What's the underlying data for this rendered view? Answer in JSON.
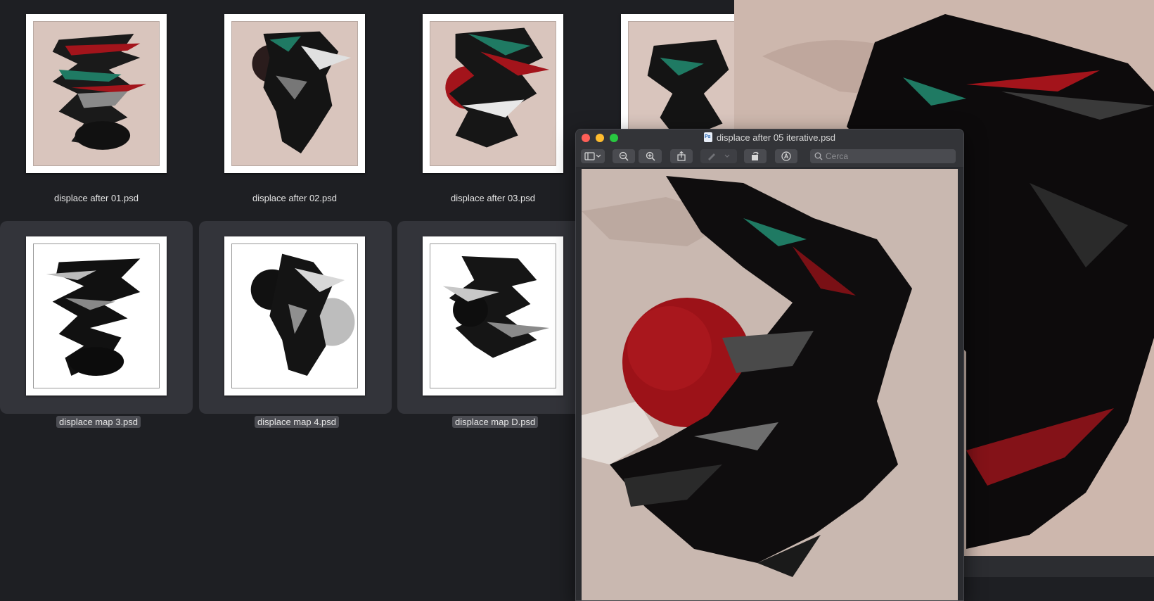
{
  "finder": {
    "files": [
      {
        "name": "displace after 01.psd",
        "selected": false,
        "style": "tinted"
      },
      {
        "name": "displace after 02.psd",
        "selected": false,
        "style": "tinted"
      },
      {
        "name": "displace after 03.psd",
        "selected": false,
        "style": "tinted"
      },
      {
        "name": "",
        "selected": false,
        "style": "tinted"
      },
      {
        "name": "displace map 3.psd",
        "selected": true,
        "style": "white"
      },
      {
        "name": "displace map 4.psd",
        "selected": true,
        "style": "white"
      },
      {
        "name": "displace map D.psd",
        "selected": true,
        "style": "white"
      }
    ]
  },
  "preview_window": {
    "title": "displace after 05 iterative.psd",
    "search_placeholder": "Cerca",
    "traffic_lights": {
      "close": "#fe5f57",
      "minimize": "#febc2e",
      "zoom": "#28c840"
    },
    "toolbar_icons": [
      "sidebar-icon",
      "zoom-out-icon",
      "zoom-in-icon",
      "share-icon",
      "markup-pen-icon",
      "rotate-icon",
      "annotate-icon",
      "search-icon"
    ]
  },
  "colors": {
    "desktop_bg": "#1e1f23",
    "artwork_bg": "#d9c5bd",
    "accent_red": "#a3141b",
    "accent_teal": "#1f7a63"
  }
}
